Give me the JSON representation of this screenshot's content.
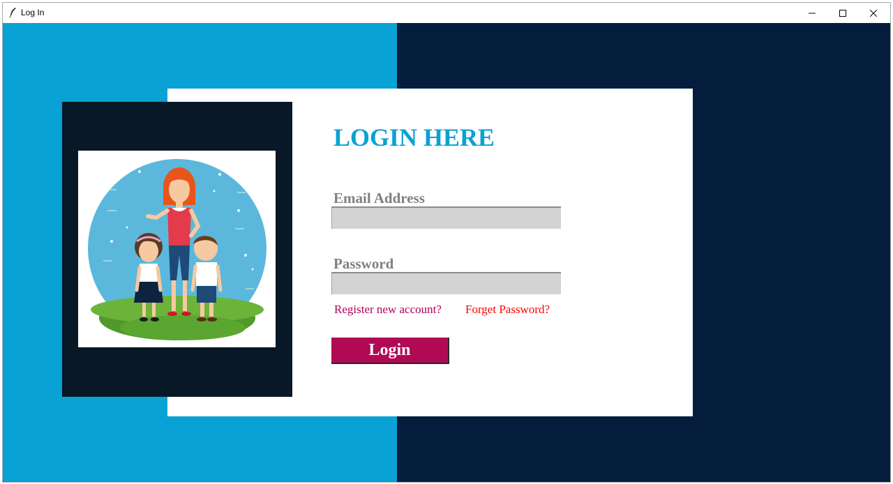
{
  "window": {
    "title": "Log In",
    "controls": {
      "minimize_icon": "minimize-icon",
      "maximize_icon": "maximize-icon",
      "close_icon": "close-icon"
    }
  },
  "colors": {
    "left_background": "#09a2d4",
    "right_background": "#041d3c",
    "card": "#ffffff",
    "image_panel": "#081826",
    "heading": "#0aa2d0",
    "label": "#808080",
    "field": "#d3d3d3",
    "register_link": "#b0005a",
    "forgot_link": "#ff0000",
    "login_button": "#b00a54"
  },
  "illustration": {
    "icon": "family-illustration"
  },
  "form": {
    "heading": "LOGIN HERE",
    "email_label": "Email Address",
    "email_value": "",
    "password_label": "Password",
    "password_value": "",
    "register_link": "Register new account?",
    "forgot_link": "Forget Password?",
    "login_button": "Login"
  }
}
